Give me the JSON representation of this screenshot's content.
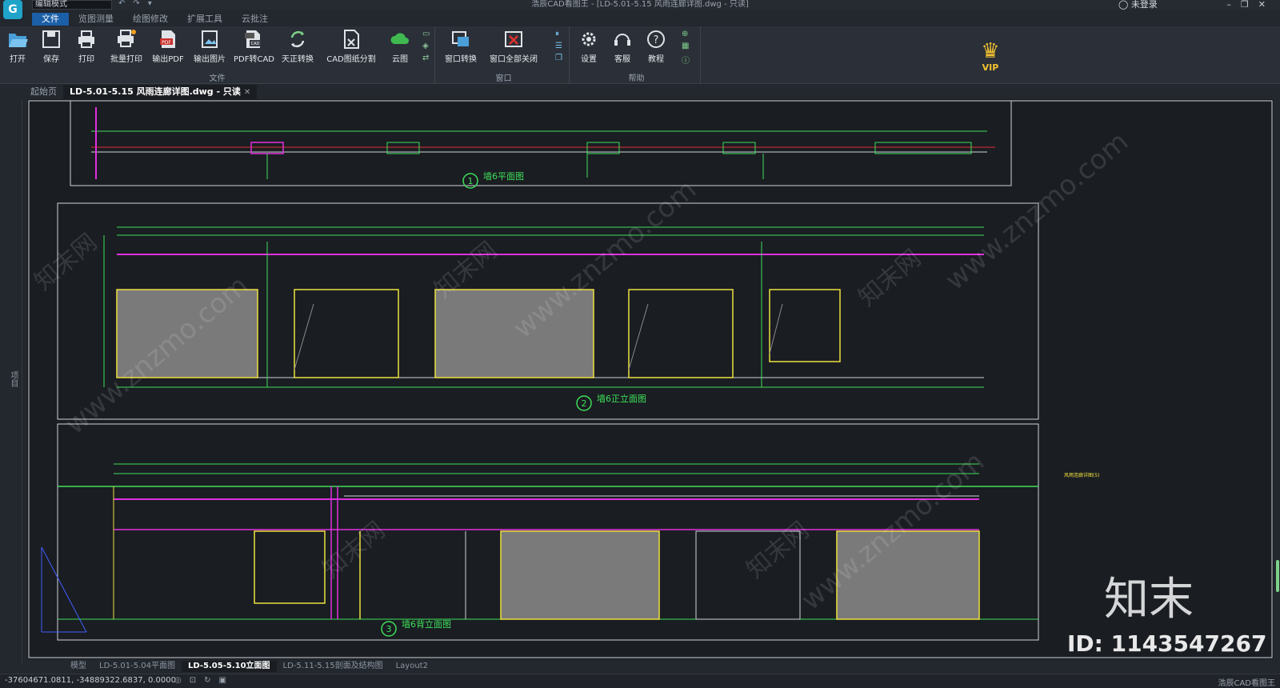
{
  "app": {
    "mode": "编辑模式",
    "window_title": "浩辰CAD看图王 - [LD-5.01-5.15 风雨连廊详图.dwg - 只读]",
    "user": "未登录",
    "logo_glyph": "G"
  },
  "menu_tabs": [
    {
      "label": "文件",
      "active": true
    },
    {
      "label": "览图测量",
      "active": false
    },
    {
      "label": "绘图修改",
      "active": false
    },
    {
      "label": "扩展工具",
      "active": false
    },
    {
      "label": "云批注",
      "active": false
    }
  ],
  "ribbon": {
    "file_group": {
      "label": "文件",
      "buttons": [
        "打开",
        "保存",
        "打印",
        "批量打印",
        "输出PDF",
        "输出图片",
        "PDF转CAD",
        "天正转换",
        "CAD图纸分割",
        "云图"
      ]
    },
    "window_group": {
      "label": "窗口",
      "buttons": [
        "窗口转换",
        "窗口全部关闭"
      ]
    },
    "help_group": {
      "label": "帮助",
      "buttons": [
        "设置",
        "客服",
        "教程"
      ]
    },
    "vip_label": "VIP"
  },
  "doc_tabs": {
    "start": "起始页",
    "current": "LD-5.01-5.15 风雨连廊详图.dwg - 只读"
  },
  "side_panel_label": "项目",
  "drawing": {
    "titles": [
      "墙6平面图",
      "墙6正立面图",
      "墙6背立面图"
    ],
    "title_numbers": [
      "1",
      "2",
      "3"
    ],
    "side_note": "风雨连廊详图(5)",
    "watermark_url": "www.znzmo.com",
    "watermark_brand": "知末网",
    "watermark_big": "知末",
    "watermark_id": "ID: 1143547267"
  },
  "layout_tabs": [
    {
      "label": "模型",
      "active": false
    },
    {
      "label": "LD-5.01-5.04平面图",
      "active": false
    },
    {
      "label": "LD-5.05-5.10立面图",
      "active": true
    },
    {
      "label": "LD-5.11-5.15剖面及结构图",
      "active": false
    },
    {
      "label": "Layout2",
      "active": false
    }
  ],
  "status": {
    "coords": "-37604671.0811, -34889322.6837, 0.0000",
    "brand": "浩辰CAD看图王"
  },
  "colors": {
    "canvas": "#1a1d22",
    "cad_green": "#3ee05a",
    "cad_yellow": "#f0e040",
    "cad_magenta": "#e030e0",
    "cad_red": "#e03030",
    "cad_white": "#d0d4d8",
    "accent": "#1b5fa8"
  }
}
